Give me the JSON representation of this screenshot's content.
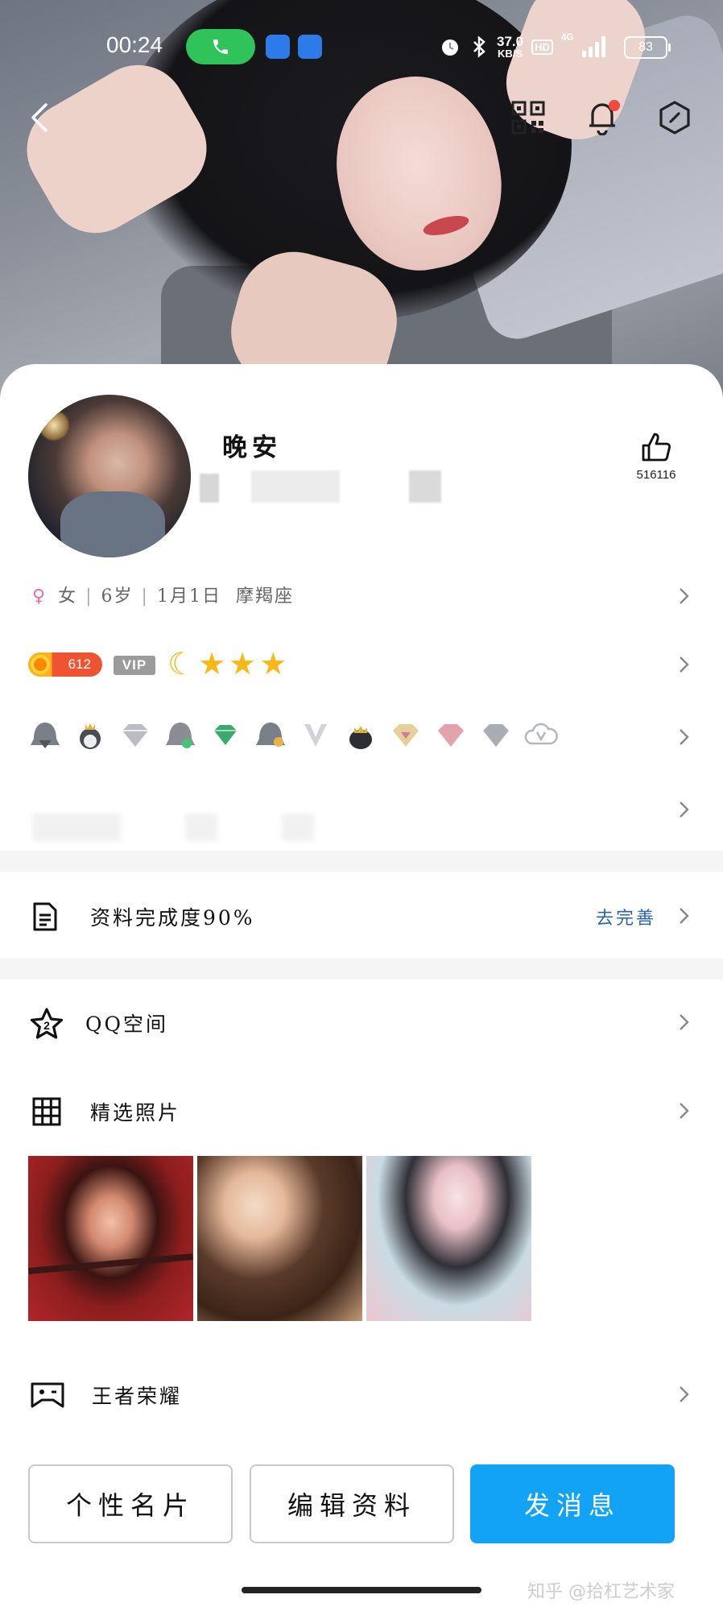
{
  "status_bar": {
    "time": "00:24",
    "net_speed_value": "37.0",
    "net_speed_unit": "KB/S",
    "hd_label": "HD",
    "network_label": "4G",
    "battery": "83"
  },
  "profile": {
    "nickname": "晚安",
    "like_count": "516116",
    "gender": "女",
    "age": "6岁",
    "birthday": "1月1日",
    "zodiac": "摩羯座",
    "level": "612",
    "vip_label": "VIP"
  },
  "completion": {
    "label": "资料完成度90%",
    "action": "去完善"
  },
  "sections": {
    "qzone": "QQ空间",
    "photos": "精选照片",
    "game": "王者荣耀"
  },
  "buttons": {
    "card": "个性名片",
    "edit": "编辑资料",
    "message": "发消息"
  },
  "watermark": "知乎 @拾杠艺术家",
  "colors": {
    "primary": "#12a2f6",
    "call_green": "#2fc35a",
    "notification_dot": "#ef4a3f",
    "link": "#2a63a8"
  },
  "icons": [
    "back-icon",
    "qr-code-icon",
    "bell-icon",
    "hexagon-settings-icon",
    "thumbs-up-icon",
    "document-icon",
    "star-icon",
    "grid-icon",
    "gamepad-icon",
    "chevron-right-icon"
  ]
}
